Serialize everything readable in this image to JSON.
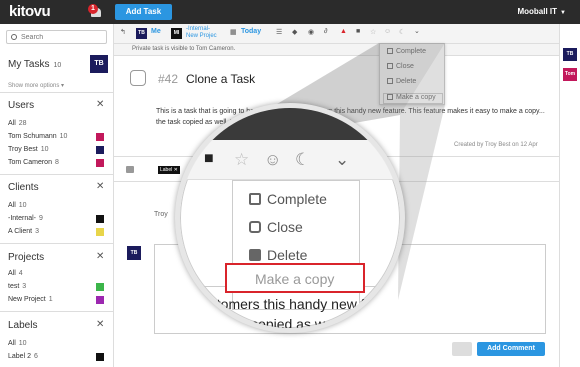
{
  "app": {
    "logo": "kitovu",
    "notification_count": "1",
    "add_task_label": "Add Task",
    "company": "Mooball IT"
  },
  "sidebar": {
    "search_placeholder": "Search",
    "my_tasks": {
      "label": "My Tasks",
      "count": "10",
      "avatar": "TB"
    },
    "show_more": "Show more options ▾",
    "users": {
      "title": "Users",
      "rows": [
        {
          "name": "All",
          "count": "28"
        },
        {
          "name": "Tom Schumann",
          "count": "10"
        },
        {
          "name": "Troy Best",
          "count": "10"
        },
        {
          "name": "Tom Cameron",
          "count": "8"
        }
      ]
    },
    "clients": {
      "title": "Clients",
      "rows": [
        {
          "name": "All",
          "count": "10"
        },
        {
          "name": "-Internal-",
          "count": "9"
        },
        {
          "name": "A Client",
          "count": "3"
        }
      ]
    },
    "projects": {
      "title": "Projects",
      "rows": [
        {
          "name": "All",
          "count": "4"
        },
        {
          "name": "test",
          "count": "3"
        },
        {
          "name": "New Project",
          "count": "1"
        }
      ]
    },
    "labels": {
      "title": "Labels",
      "rows": [
        {
          "name": "All",
          "count": "10"
        },
        {
          "name": "Label 2",
          "count": "6"
        }
      ]
    }
  },
  "toolbar": {
    "assignee_avatar": "TB",
    "assignee_label": "Me",
    "project_avatar": "MI",
    "project_line1": "-Internal-",
    "project_line2": "New Projec",
    "today_label": "Today",
    "private_notice": "Private task is visible to Tom Cameron."
  },
  "menu": {
    "complete": "Complete",
    "close": "Close",
    "delete": "Delete",
    "copy": "Make a copy"
  },
  "task": {
    "number": "#42",
    "title": "Clone a Task",
    "description": "This is a task that is going to hand... show our customers this handy new feature. This feature makes it easy to make a copy... the task copied as well. We hope everyone like this feature.",
    "created": "Created by Troy Best on 12 Apr",
    "label": "Label ✕",
    "commenter": "Troy",
    "comment_avatar": "TB",
    "add_comment": "Add Comment"
  },
  "rail": {
    "av1": "TB",
    "av2": "Tom"
  },
  "zoom": {
    "text_line1": "ustomers this handy new featu",
    "text_line2": "he task copied as well. W"
  },
  "colors": {
    "accent": "#2b96e1",
    "dark": "#2b2b2b",
    "highlight": "#d9242b",
    "navy": "#1b1b5c",
    "user_pink": "#c2185b"
  }
}
